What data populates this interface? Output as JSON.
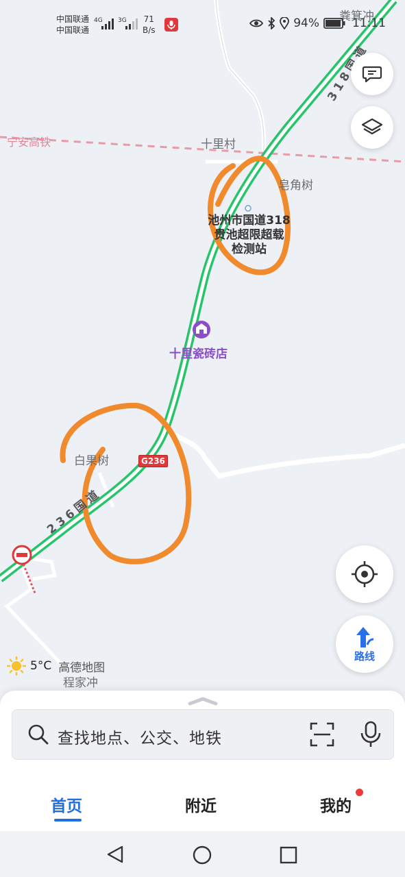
{
  "status_bar": {
    "carrier_1": "中国联通",
    "carrier_2": "中国联通",
    "net_1": "4G",
    "net_2": "3G",
    "speed_value": "71",
    "speed_unit": "B/s",
    "battery": "94%",
    "time": "11:11"
  },
  "map": {
    "labels": {
      "top_right_village": "粪箕冲",
      "railway": "宁安高铁",
      "village_shili": "十里村",
      "place_zaojiaoshu": "皂角树",
      "station_line1": "池州市国道318",
      "station_line2": "贵池超限超载",
      "station_line3": "检测站",
      "poi_tile_shop": "十里瓷砖店",
      "village_baiguoshu": "白果树",
      "place_chengjiachong": "程家冲",
      "road_shield": "G236",
      "road_236_name": "236国道",
      "road_318_name": "318国道"
    },
    "colors": {
      "highway": "#27c46b",
      "annotation": "#f08a2c",
      "poi": "#8a4fc7",
      "railway": "#e89aa6"
    }
  },
  "controls": {
    "route_label": "路线"
  },
  "weather": {
    "temperature": "5°C",
    "brand": "高德地图"
  },
  "search": {
    "placeholder": "查找地点、公交、地铁"
  },
  "tabs": [
    {
      "label": "首页",
      "active": true
    },
    {
      "label": "附近",
      "active": false
    },
    {
      "label": "我的",
      "active": false
    }
  ]
}
